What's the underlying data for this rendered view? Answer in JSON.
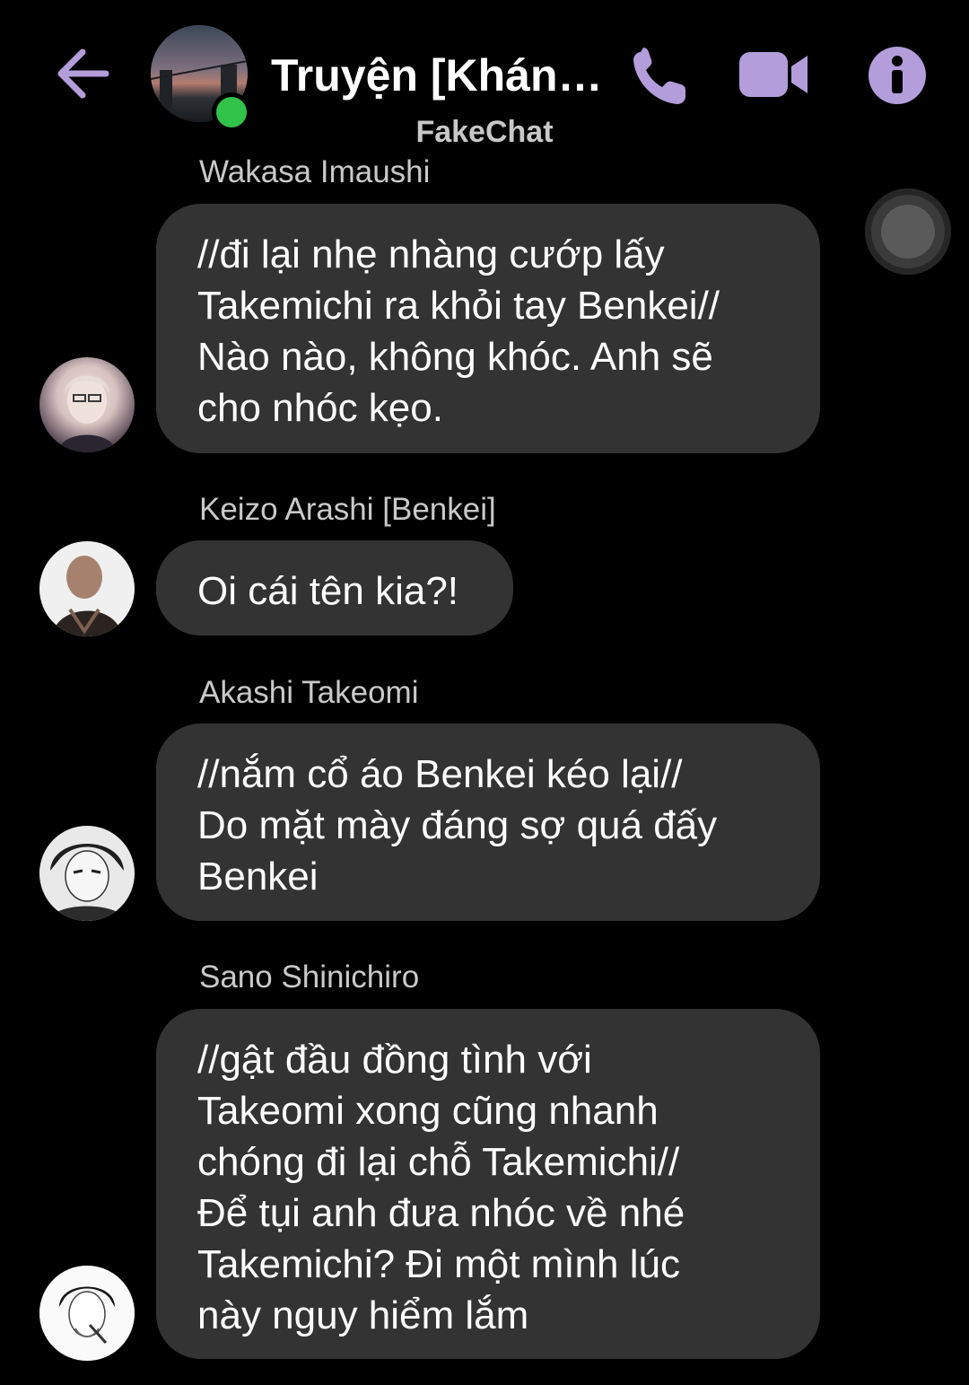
{
  "header": {
    "title": "Truyện [Kháng ...",
    "back_icon": "back-arrow-icon",
    "call_icon": "phone-icon",
    "video_icon": "video-camera-icon",
    "info_icon": "info-icon",
    "accent_color": "#b39ddb",
    "online_color": "#31c24a"
  },
  "watermark": "FakeChat",
  "messages": [
    {
      "sender": "Wakasa Imaushi",
      "text": "//đi lại nhẹ nhàng cướp lấy\nTakemichi ra khỏi tay Benkei//\nNào nào, không khóc. Anh sẽ\ncho nhóc kẹo."
    },
    {
      "sender": "Keizo Arashi [Benkei]",
      "text": "Oi cái tên kia?!"
    },
    {
      "sender": "Akashi Takeomi",
      "text": "//nắm cổ áo Benkei kéo lại//\nDo mặt mày đáng sợ quá đấy\nBenkei"
    },
    {
      "sender": "Sano Shinichiro",
      "text": "//gật đầu đồng tình với\nTakeomi xong cũng nhanh\nchóng đi lại chỗ Takemichi//\nĐể tụi anh đưa nhóc về nhé\nTakemichi? Đi một mình lúc\nnày nguy hiểm lắm"
    }
  ],
  "colors": {
    "background": "#000000",
    "bubble": "#333334",
    "sender_text": "#c9c9c9"
  }
}
